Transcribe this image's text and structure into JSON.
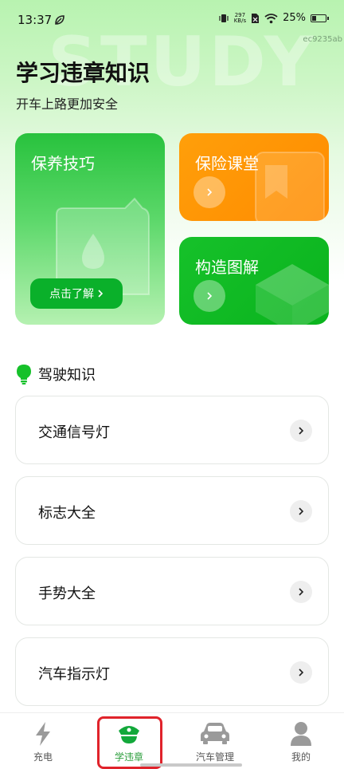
{
  "status_bar": {
    "time": "13:37",
    "net_speed_value": "297",
    "net_speed_unit": "KB/s",
    "battery": "25%"
  },
  "device_id": "ec9235ab",
  "watermark": "STUDY",
  "header": {
    "title": "学习违章知识",
    "subtitle": "开车上路更加安全"
  },
  "cards": {
    "maintenance": {
      "title": "保养技巧",
      "button": "点击了解"
    },
    "insurance": {
      "title": "保险课堂"
    },
    "structure": {
      "title": "构造图解"
    }
  },
  "section": {
    "title": "驾驶知识",
    "icon": "lightbulb-icon"
  },
  "list": [
    {
      "label": "交通信号灯"
    },
    {
      "label": "标志大全"
    },
    {
      "label": "手势大全"
    },
    {
      "label": "汽车指示灯"
    }
  ],
  "tabs": [
    {
      "label": "充电",
      "icon": "lightning-icon"
    },
    {
      "label": "学违章",
      "icon": "police-cap-icon",
      "active": true
    },
    {
      "label": "汽车管理",
      "icon": "car-icon"
    },
    {
      "label": "我的",
      "icon": "person-icon"
    }
  ],
  "colors": {
    "brand_green": "#16c12a",
    "orange": "#ff9200",
    "active_tab": "#2c9e3c",
    "highlight_red": "#e0232b"
  }
}
